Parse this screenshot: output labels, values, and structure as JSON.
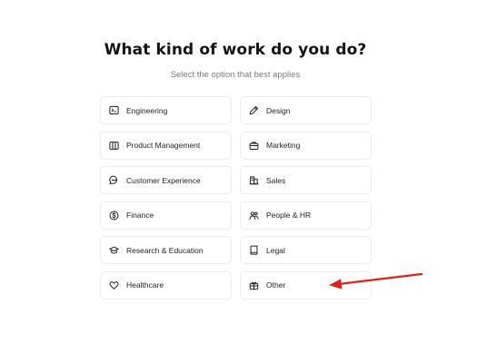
{
  "header": {
    "title": "What kind of work do you do?",
    "subtitle": "Select the option that best applies"
  },
  "options": [
    {
      "label": "Engineering",
      "icon": "terminal-icon"
    },
    {
      "label": "Design",
      "icon": "pencil-icon"
    },
    {
      "label": "Product Management",
      "icon": "columns-icon"
    },
    {
      "label": "Marketing",
      "icon": "briefcase-icon"
    },
    {
      "label": "Customer Experience",
      "icon": "chat-bubble-icon"
    },
    {
      "label": "Sales",
      "icon": "storefront-icon"
    },
    {
      "label": "Finance",
      "icon": "dollar-coin-icon"
    },
    {
      "label": "People & HR",
      "icon": "people-icon"
    },
    {
      "label": "Research & Education",
      "icon": "graduation-cap-icon"
    },
    {
      "label": "Legal",
      "icon": "book-icon"
    },
    {
      "label": "Healthcare",
      "icon": "heart-icon"
    },
    {
      "label": "Other",
      "icon": "gift-icon"
    }
  ],
  "annotation": {
    "arrow_color": "#e0201a"
  }
}
